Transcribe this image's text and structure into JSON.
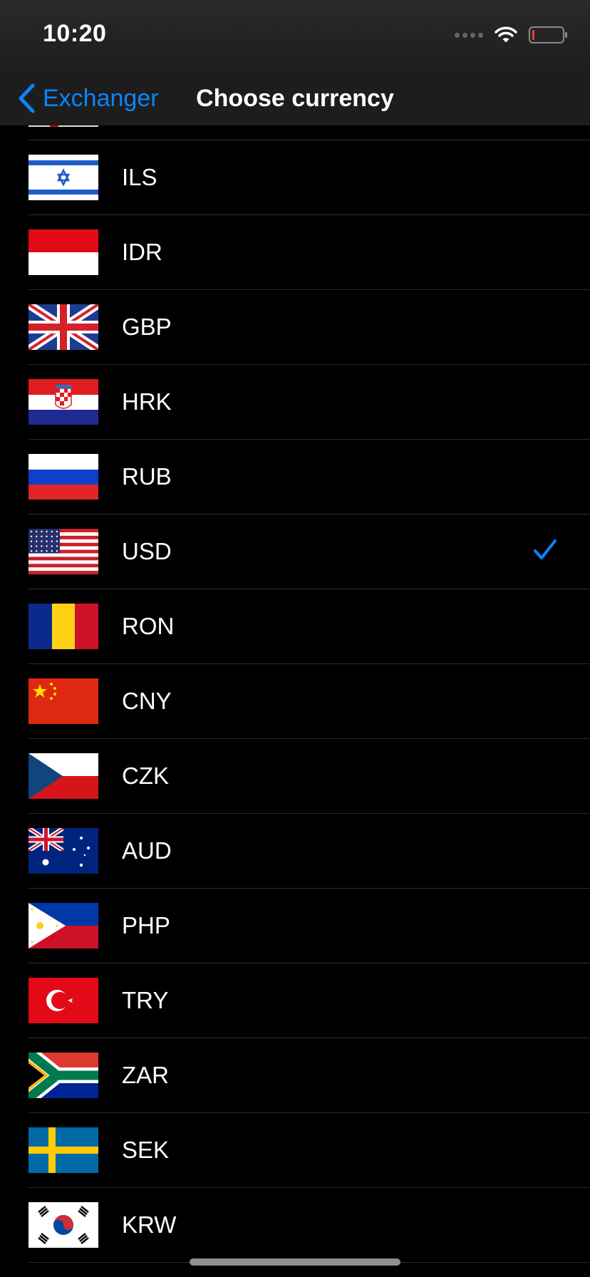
{
  "status_bar": {
    "time": "10:20"
  },
  "nav": {
    "back_label": "Exchanger",
    "title": "Choose currency"
  },
  "colors": {
    "accent": "#0a84ff",
    "background": "#000000",
    "nav_background": "#1d1d1d",
    "separator": "#2c2c2e"
  },
  "currencies": [
    {
      "code": "ILS",
      "flag_icon": "israel-flag-icon",
      "selected": false
    },
    {
      "code": "IDR",
      "flag_icon": "indonesia-flag-icon",
      "selected": false
    },
    {
      "code": "GBP",
      "flag_icon": "uk-flag-icon",
      "selected": false
    },
    {
      "code": "HRK",
      "flag_icon": "croatia-flag-icon",
      "selected": false
    },
    {
      "code": "RUB",
      "flag_icon": "russia-flag-icon",
      "selected": false
    },
    {
      "code": "USD",
      "flag_icon": "usa-flag-icon",
      "selected": true
    },
    {
      "code": "RON",
      "flag_icon": "romania-flag-icon",
      "selected": false
    },
    {
      "code": "CNY",
      "flag_icon": "china-flag-icon",
      "selected": false
    },
    {
      "code": "CZK",
      "flag_icon": "czech-flag-icon",
      "selected": false
    },
    {
      "code": "AUD",
      "flag_icon": "australia-flag-icon",
      "selected": false
    },
    {
      "code": "PHP",
      "flag_icon": "philippines-flag-icon",
      "selected": false
    },
    {
      "code": "TRY",
      "flag_icon": "turkey-flag-icon",
      "selected": false
    },
    {
      "code": "ZAR",
      "flag_icon": "south-africa-flag-icon",
      "selected": false
    },
    {
      "code": "SEK",
      "flag_icon": "sweden-flag-icon",
      "selected": false
    },
    {
      "code": "KRW",
      "flag_icon": "south-korea-flag-icon",
      "selected": false
    }
  ]
}
